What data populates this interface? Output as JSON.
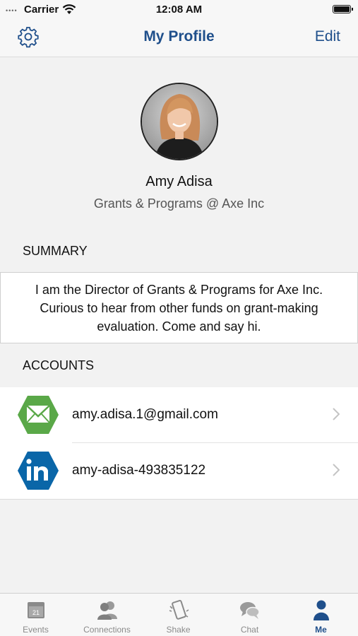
{
  "status_bar": {
    "dots": "••••",
    "carrier": "Carrier",
    "time": "12:08 AM"
  },
  "nav": {
    "title": "My Profile",
    "edit_label": "Edit"
  },
  "profile": {
    "name": "Amy Adisa",
    "subtitle": "Grants & Programs @ Axe Inc"
  },
  "summary": {
    "header": "SUMMARY",
    "text": "I am the Director of Grants & Programs for Axe Inc. Curious to hear from other funds on grant-making evaluation. Come and say hi."
  },
  "accounts": {
    "header": "ACCOUNTS",
    "items": [
      {
        "icon": "mail-icon",
        "label": "amy.adisa.1@gmail.com",
        "color": "#5aa848"
      },
      {
        "icon": "linkedin-icon",
        "label": "amy-adisa-493835122",
        "color": "#0a66a8"
      }
    ]
  },
  "tabs": [
    {
      "icon": "calendar-icon",
      "label": "Events",
      "badge": "21",
      "active": false
    },
    {
      "icon": "connections-icon",
      "label": "Connections",
      "active": false
    },
    {
      "icon": "shake-icon",
      "label": "Shake",
      "active": false
    },
    {
      "icon": "chat-icon",
      "label": "Chat",
      "active": false
    },
    {
      "icon": "person-icon",
      "label": "Me",
      "active": true
    }
  ],
  "colors": {
    "accent": "#1f4f8b",
    "background": "#f2f2f2",
    "inactive": "#8a8a8a"
  }
}
